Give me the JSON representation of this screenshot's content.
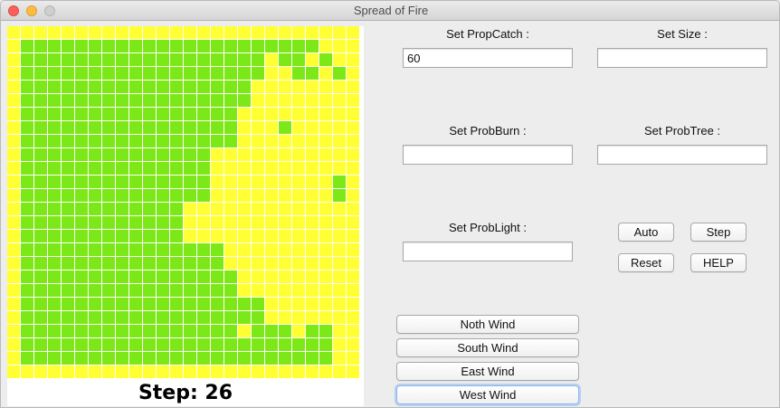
{
  "window": {
    "title": "Spread of Fire"
  },
  "colors": {
    "tree": "#7de817",
    "empty": "#ffff33",
    "gridline": "#ffffff"
  },
  "sim": {
    "step_text": "Step: 26",
    "grid": {
      "cols": 26,
      "rows": 26,
      "tree_runs": [
        [],
        [
          [
            1,
            22
          ]
        ],
        [
          [
            1,
            18
          ],
          [
            20,
            21
          ],
          [
            23,
            23
          ]
        ],
        [
          [
            1,
            18
          ],
          [
            21,
            22
          ],
          [
            24,
            24
          ]
        ],
        [
          [
            1,
            17
          ]
        ],
        [
          [
            1,
            17
          ]
        ],
        [
          [
            1,
            16
          ]
        ],
        [
          [
            1,
            16
          ],
          [
            20,
            20
          ]
        ],
        [
          [
            1,
            16
          ]
        ],
        [
          [
            1,
            14
          ]
        ],
        [
          [
            1,
            14
          ]
        ],
        [
          [
            1,
            14
          ],
          [
            24,
            24
          ]
        ],
        [
          [
            1,
            14
          ],
          [
            24,
            24
          ]
        ],
        [
          [
            1,
            12
          ]
        ],
        [
          [
            1,
            12
          ]
        ],
        [
          [
            1,
            12
          ]
        ],
        [
          [
            1,
            15
          ]
        ],
        [
          [
            1,
            15
          ]
        ],
        [
          [
            1,
            16
          ]
        ],
        [
          [
            1,
            16
          ]
        ],
        [
          [
            1,
            16
          ],
          [
            17,
            18
          ]
        ],
        [
          [
            1,
            16
          ],
          [
            17,
            18
          ]
        ],
        [
          [
            1,
            16
          ],
          [
            18,
            20
          ],
          [
            22,
            23
          ]
        ],
        [
          [
            1,
            20
          ],
          [
            21,
            23
          ]
        ],
        [
          [
            1,
            23
          ]
        ],
        []
      ]
    }
  },
  "controls": {
    "propcatch": {
      "label": "Set PropCatch :",
      "value": "60"
    },
    "size": {
      "label": "Set Size :",
      "value": ""
    },
    "probburn": {
      "label": "Set ProbBurn :",
      "value": ""
    },
    "probtree": {
      "label": "Set ProbTree :",
      "value": ""
    },
    "problight": {
      "label": "Set ProbLight :",
      "value": ""
    }
  },
  "buttons": {
    "auto": "Auto",
    "step": "Step",
    "reset": "Reset",
    "help": "HELP",
    "north_wind": "Noth Wind",
    "south_wind": "South Wind",
    "east_wind": "East Wind",
    "west_wind": "West Wind"
  }
}
